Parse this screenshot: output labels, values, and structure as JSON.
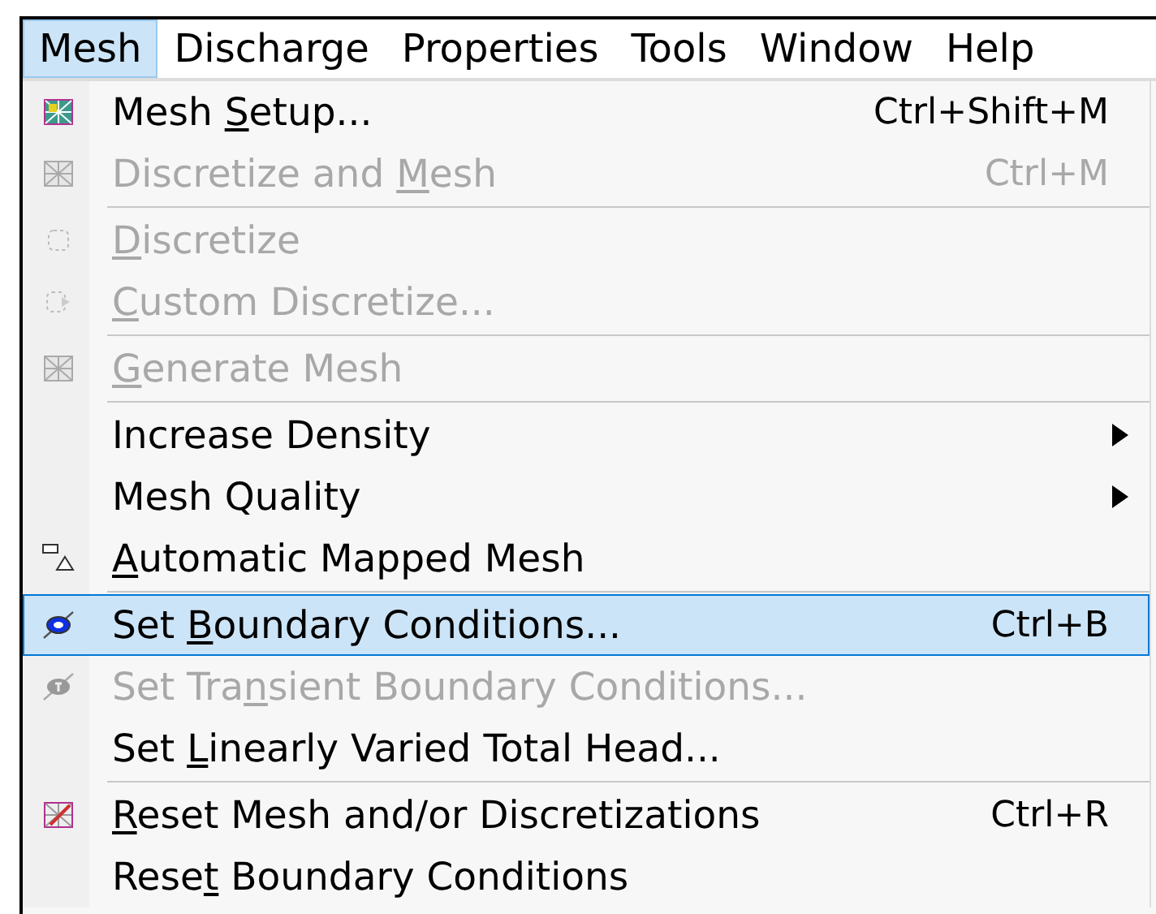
{
  "menubar": [
    {
      "label": "Mesh",
      "selected": true
    },
    {
      "label": "Discharge",
      "selected": false
    },
    {
      "label": "Properties",
      "selected": false
    },
    {
      "label": "Tools",
      "selected": false
    },
    {
      "label": "Window",
      "selected": false
    },
    {
      "label": "Help",
      "selected": false
    }
  ],
  "menu": [
    {
      "kind": "item",
      "label": {
        "before": "Mesh ",
        "key": "S",
        "after": "etup..."
      },
      "shortcut": "Ctrl+Shift+M",
      "disabled": false,
      "selected": false,
      "submenu": false
    },
    {
      "kind": "item",
      "label": {
        "before": "Discretize and ",
        "key": "M",
        "after": "esh"
      },
      "shortcut": "Ctrl+M",
      "disabled": true,
      "selected": false,
      "submenu": false
    },
    {
      "kind": "separator"
    },
    {
      "kind": "item",
      "label": {
        "key": "D",
        "after": "iscretize"
      },
      "disabled": true,
      "selected": false,
      "submenu": false
    },
    {
      "kind": "item",
      "label": {
        "key": "C",
        "after": "ustom Discretize..."
      },
      "disabled": true,
      "selected": false,
      "submenu": false
    },
    {
      "kind": "separator"
    },
    {
      "kind": "item",
      "label": {
        "key": "G",
        "after": "enerate Mesh"
      },
      "disabled": true,
      "selected": false,
      "submenu": false
    },
    {
      "kind": "separator"
    },
    {
      "kind": "item",
      "label": {
        "before": "Increase Density"
      },
      "disabled": false,
      "selected": false,
      "submenu": true
    },
    {
      "kind": "item",
      "label": {
        "before": "Mesh Quality"
      },
      "disabled": false,
      "selected": false,
      "submenu": true
    },
    {
      "kind": "item",
      "label": {
        "key": "A",
        "after": "utomatic Mapped Mesh"
      },
      "disabled": false,
      "selected": false,
      "submenu": false
    },
    {
      "kind": "separator"
    },
    {
      "kind": "item",
      "label": {
        "before": "Set ",
        "key": "B",
        "after": "oundary Conditions..."
      },
      "shortcut": "Ctrl+B",
      "disabled": false,
      "selected": true,
      "submenu": false
    },
    {
      "kind": "item",
      "label": {
        "before": "Set Tra",
        "key": "n",
        "after": "sient Boundary Conditions..."
      },
      "disabled": true,
      "selected": false,
      "submenu": false
    },
    {
      "kind": "item",
      "label": {
        "before": "Set ",
        "key": "L",
        "after": "inearly Varied Total Head..."
      },
      "disabled": false,
      "selected": false,
      "submenu": false
    },
    {
      "kind": "separator"
    },
    {
      "kind": "item",
      "label": {
        "key": "R",
        "after": "eset Mesh and/or Discretizations"
      },
      "shortcut": "Ctrl+R",
      "disabled": false,
      "selected": false,
      "submenu": false
    },
    {
      "kind": "item",
      "label": {
        "before": "Rese",
        "key": "t",
        "after": " Boundary Conditions"
      },
      "disabled": false,
      "selected": false,
      "submenu": false
    }
  ]
}
